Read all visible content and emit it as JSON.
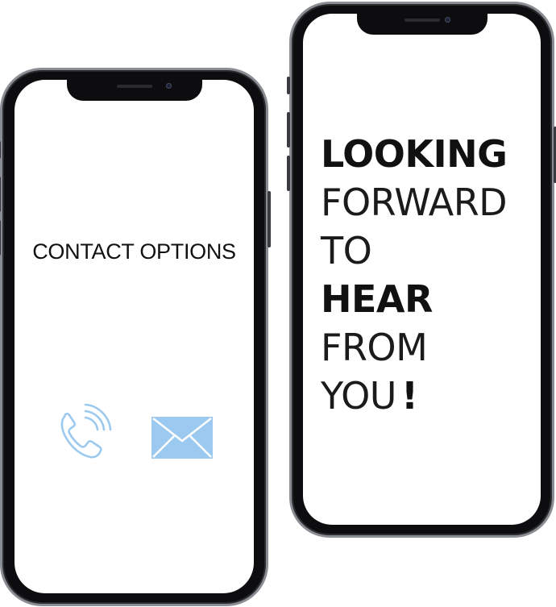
{
  "left_phone": {
    "title": "CONTACT OPTIONS",
    "icons": [
      {
        "name": "phone-call-icon"
      },
      {
        "name": "envelope-icon"
      }
    ],
    "icon_color": "#9cc9ef"
  },
  "right_phone": {
    "lines": [
      {
        "text": "LOOKING",
        "weight": "bold"
      },
      {
        "text": "FORWARD",
        "weight": "light"
      },
      {
        "text": "TO",
        "weight": "light"
      },
      {
        "text": "HEAR",
        "weight": "bold"
      },
      {
        "text": "FROM",
        "weight": "light"
      },
      {
        "text": "YOU",
        "weight": "light"
      }
    ],
    "exclamation": "!"
  },
  "colors": {
    "frame": "#0d0d0f",
    "bezel": "#8a8d93",
    "screen": "#ffffff",
    "text": "#111111"
  }
}
